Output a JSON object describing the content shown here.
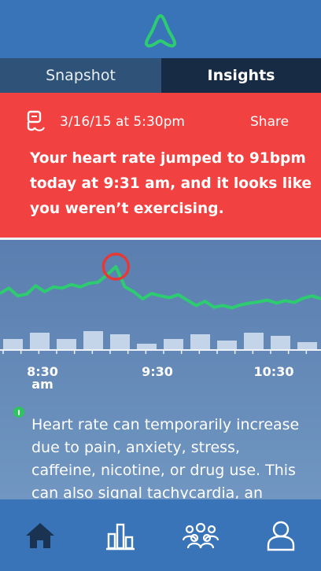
{
  "tabs": {
    "snapshot": "Snapshot",
    "insights": "Insights",
    "active": "insights"
  },
  "alert": {
    "date": "3/16/15  at 5:30pm",
    "share_label": "Share",
    "message": "Your heart rate jumped to 91bpm today at 9:31 am, and it looks like you weren’t exercising.",
    "background_color": "#f14140",
    "icon": "scale-icon"
  },
  "chart": {
    "x_labels": [
      {
        "text": "8:30",
        "sub": "am"
      },
      {
        "text": "9:30",
        "sub": ""
      },
      {
        "text": "10:30",
        "sub": ""
      }
    ],
    "line_color": "#2ecc71",
    "highlight_color": "#e53935"
  },
  "chart_data": {
    "type": "line",
    "series": [
      {
        "values": [
          55,
          64,
          51,
          54,
          68,
          58,
          66,
          64,
          70,
          66,
          72,
          74,
          86,
          100,
          66,
          58,
          46,
          55,
          51,
          48,
          53,
          44,
          35,
          42,
          32,
          35,
          31,
          36,
          39,
          41,
          44,
          39,
          43,
          40,
          47,
          51,
          46
        ]
      }
    ],
    "bars": [
      7,
      11,
      7,
      12,
      10,
      4,
      7,
      10,
      6,
      11,
      9,
      5
    ],
    "peak_index": 13
  },
  "info": {
    "icon": "info-icon",
    "text": "Heart rate can temporarily increase due to pain, anxiety, stress, caffeine, nicotine, or drug use. This can also signal tachycardia, an abnormally"
  },
  "nav": {
    "items": [
      "home-icon",
      "stats-icon",
      "community-icon",
      "profile-icon"
    ]
  }
}
